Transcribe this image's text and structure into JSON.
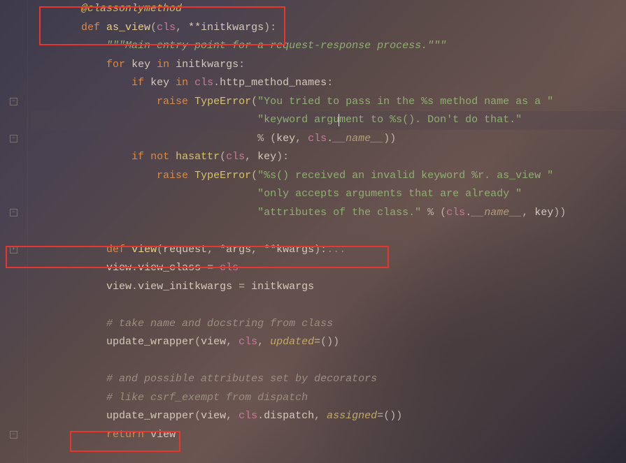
{
  "gutter": {
    "rows": [
      "",
      "",
      "",
      "",
      "",
      "minus",
      "",
      "minus",
      "",
      "",
      "",
      "minus",
      "",
      "plus",
      "",
      "",
      "",
      "",
      "",
      "",
      "",
      "",
      "",
      "minus"
    ]
  },
  "tokens": {
    "decorator": "@classonlymethod",
    "def": "def",
    "as_view": "as_view",
    "cls": "cls",
    "initkwargs_star": "**initkwargs",
    "docstring": "\"\"\"Main entry point for a request-response process.\"\"\"",
    "for": "for",
    "key": "key",
    "in": "in",
    "initkwargs": "initkwargs",
    "if": "if",
    "http_method_names": "http_method_names",
    "raise": "raise",
    "TypeError": "TypeError",
    "str1a": "\"You tried to pass in the %s method name as a \"",
    "str1b": "\"keyword argument to %s(). Don't do that.\"",
    "pct": "%",
    "dunder_name": "__name__",
    "not": "not",
    "hasattr": "hasattr",
    "str2a": "\"%s() received an invalid keyword %r. as_view \"",
    "str2b": "\"only accepts arguments that are already \"",
    "str2c": "\"attributes of the class.\"",
    "view": "view",
    "request": "request",
    "args_star": "*args",
    "kwargs_star": "**kwargs",
    "ellipsis": "...",
    "view_class": "view_class",
    "eq": " = ",
    "view_initkwargs": "view_initkwargs",
    "comment1": "# take name and docstring from class",
    "update_wrapper": "update_wrapper",
    "updated": "updated",
    "empty_tuple": "=()",
    "comment2": "# and possible attributes set by decorators",
    "comment3": "# like csrf_exempt from dispatch",
    "dispatch": "dispatch",
    "assigned": "assigned",
    "return": "return"
  },
  "indent": {
    "i2": "        ",
    "i3": "            ",
    "i4": "                ",
    "i5": "                    ",
    "i6": "                        ",
    "i9": "                                    "
  }
}
